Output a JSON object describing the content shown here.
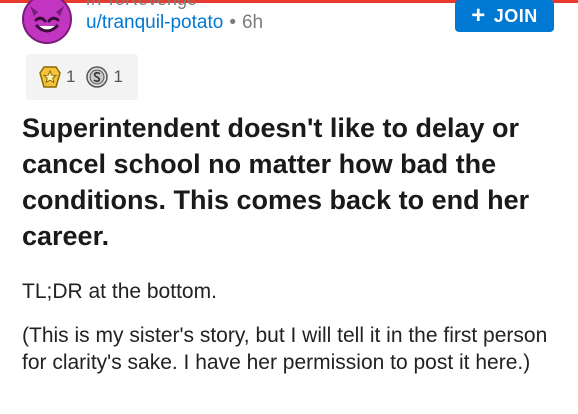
{
  "header": {
    "subreddit": "r/ProRevenge",
    "username": "u/tranquil-potato",
    "separator": "•",
    "age": "6h",
    "join_label": "JOIN",
    "join_icon": "+"
  },
  "awards": [
    {
      "icon": "gold-award-icon",
      "count": "1"
    },
    {
      "icon": "silver-award-icon",
      "count": "1"
    }
  ],
  "post": {
    "title": "Superintendent doesn't like to delay or cancel school no matter how bad the conditions. This comes back to end her career.",
    "paragraphs": [
      "TL;DR at the bottom.",
      "(This is my sister's story, but I will tell it in the first person for clarity's sake. I have her permission to post it here.)"
    ]
  },
  "colors": {
    "accent": "#0079d3",
    "top_rule": "#e8392f",
    "avatar": "#c135c0"
  }
}
